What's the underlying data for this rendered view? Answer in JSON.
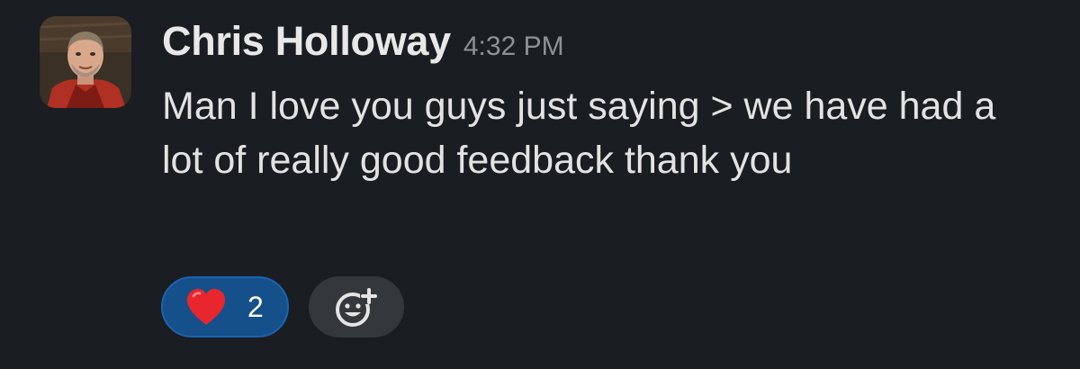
{
  "message": {
    "author": "Chris Holloway",
    "timestamp": "4:32 PM",
    "text": "Man I love you guys just saying > we have had a lot of really good feedback thank you"
  },
  "reactions": [
    {
      "emoji": "red-heart",
      "count": "2",
      "selected": true
    }
  ],
  "colors": {
    "background": "#1a1d21",
    "reaction_selected_bg": "#15508a",
    "add_reaction_bg": "#34373c"
  },
  "icons": {
    "add_reaction": "add-emoji-icon",
    "heart": "heart-emoji-icon"
  }
}
